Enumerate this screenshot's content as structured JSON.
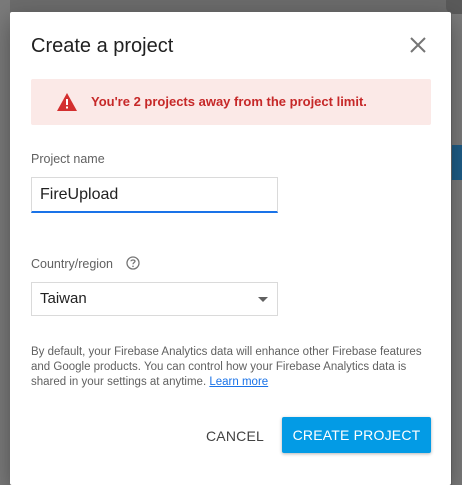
{
  "dialog": {
    "title": "Create a project",
    "close_icon": "close-icon"
  },
  "warning": {
    "icon": "warning-icon",
    "text": "You're 2 projects away from the project limit.",
    "text_color": "#c62828",
    "background": "#fbe9e7"
  },
  "project_name": {
    "label": "Project name",
    "value": "FireUpload"
  },
  "country": {
    "label": "Country/region",
    "help_icon": "help-icon",
    "selected": "Taiwan"
  },
  "disclaimer": {
    "text": "By default, your Firebase Analytics data will enhance other Firebase features and Google products. You can control how your Firebase Analytics data is shared in your settings at anytime.",
    "link": "Learn more"
  },
  "actions": {
    "cancel_label": "CANCEL",
    "create_label": "CREATE PROJECT",
    "primary_color": "#039be5"
  }
}
